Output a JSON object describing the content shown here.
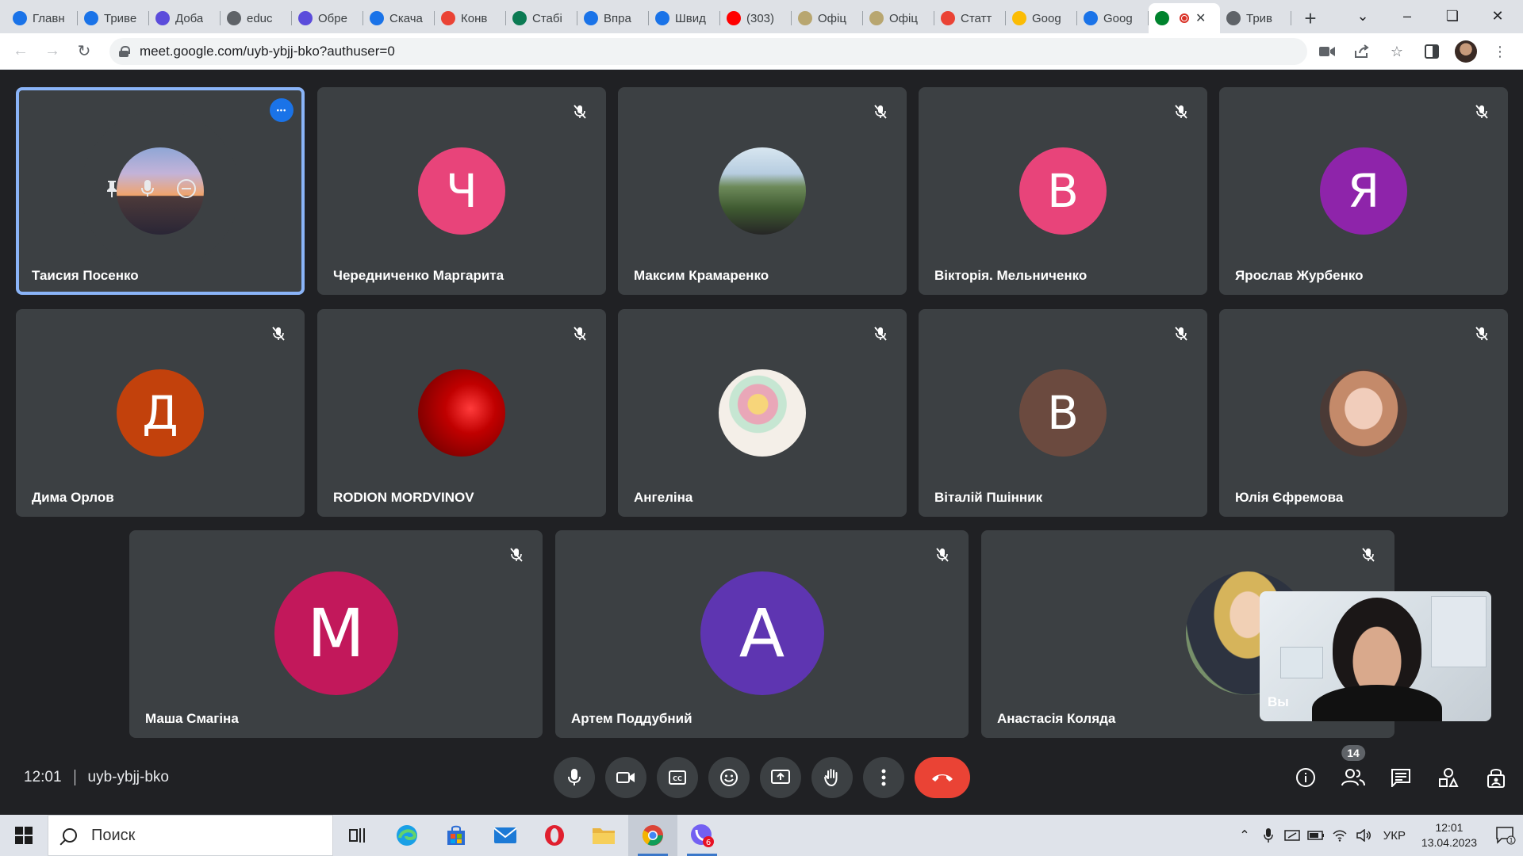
{
  "browser": {
    "tabs": [
      {
        "label": "Главн",
        "color": "#1a73e8"
      },
      {
        "label": "Триве",
        "color": "#1a73e8"
      },
      {
        "label": "Доба",
        "color": "#5b4cdb"
      },
      {
        "label": "educ",
        "color": "#5f6368"
      },
      {
        "label": "Обре",
        "color": "#5b4cdb"
      },
      {
        "label": "Скача",
        "color": "#1a73e8"
      },
      {
        "label": "Конв",
        "color": "#ea4335"
      },
      {
        "label": "Стабі",
        "color": "#0b7a53"
      },
      {
        "label": "Впра",
        "color": "#1a73e8"
      },
      {
        "label": "Швид",
        "color": "#1a73e8"
      },
      {
        "label": "(303)",
        "color": "#ff0000"
      },
      {
        "label": "Офіц",
        "color": "#b8a670"
      },
      {
        "label": "Офіц",
        "color": "#b8a670"
      },
      {
        "label": "Статт",
        "color": "#ea4335"
      },
      {
        "label": "Goog",
        "color": "#fbbc04"
      },
      {
        "label": "Goog",
        "color": "#1a73e8"
      },
      {
        "label": "",
        "color": "#00832d",
        "active": true
      },
      {
        "label": "Трив",
        "color": "#5f6368"
      }
    ],
    "new_tab": "+",
    "url": "meet.google.com/uyb-ybjj-bko?authuser=0"
  },
  "participants": [
    {
      "name": "Таисия Посенко",
      "initial": "",
      "color": "#3c4043",
      "photo": "sunset",
      "speaking": true
    },
    {
      "name": "Чередниченко Маргарита",
      "initial": "Ч",
      "color": "#e8447a"
    },
    {
      "name": "Максим Крамаренко",
      "initial": "",
      "color": "#6d8a5a",
      "photo": "moto"
    },
    {
      "name": "Вікторія. Мельниченко",
      "initial": "В",
      "color": "#e8447a"
    },
    {
      "name": "Ярослав Журбенко",
      "initial": "Я",
      "color": "#8e24aa"
    },
    {
      "name": "Дима Орлов",
      "initial": "Д",
      "color": "#c2410c"
    },
    {
      "name": "RODION MORDVINOV",
      "initial": "",
      "color": "#8b0000",
      "photo": "red"
    },
    {
      "name": "Ангеліна",
      "initial": "",
      "color": "#e8e3dd",
      "photo": "macarons"
    },
    {
      "name": "Віталій Пшінник",
      "initial": "В",
      "color": "#6b4a3f"
    },
    {
      "name": "Юлія Єфремова",
      "initial": "",
      "color": "#c79a86",
      "photo": "girl"
    },
    {
      "name": "Маша Смагіна",
      "initial": "М",
      "color": "#c2185b"
    },
    {
      "name": "Артем Поддубний",
      "initial": "А",
      "color": "#5e35b1"
    },
    {
      "name": "Анастасія Коляда",
      "initial": "",
      "color": "#7a6b5c",
      "photo": "girl2"
    }
  ],
  "self_view": {
    "label": "Вы"
  },
  "meeting": {
    "time": "12:01",
    "code": "uyb-ybjj-bko",
    "participant_count": "14"
  },
  "taskbar": {
    "search_placeholder": "Поиск",
    "lang": "УКР",
    "time": "12:01",
    "date": "13.04.2023",
    "viber_badge": "6"
  }
}
